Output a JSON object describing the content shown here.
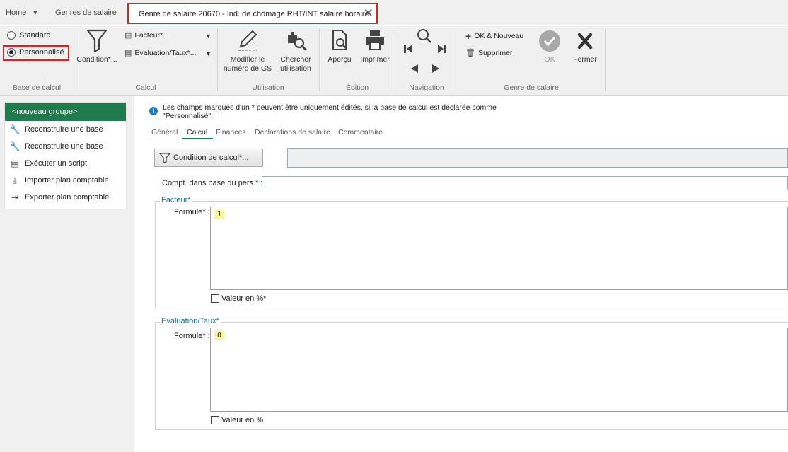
{
  "tabs": {
    "home": "Home",
    "genres": "Genres de salaire",
    "active": "Genre de salaire 20670 - Ind. de chômage RHT/INT salaire horaire"
  },
  "ribbon": {
    "base_calcul": {
      "standard": "Standard",
      "personnalise": "Personnalisé",
      "selected": "Personnalisé",
      "label": "Base de calcul"
    },
    "calcul": {
      "condition": "Condition*...",
      "facteur": "Facteur*...",
      "evaluation": "Evaluation/Taux*...",
      "label": "Calcul"
    },
    "utilisation": {
      "modifier_l1": "Modifier le",
      "modifier_l2": "numéro de GS",
      "chercher_l1": "Chercher",
      "chercher_l2": "utilisation",
      "label": "Utilisation"
    },
    "edition": {
      "apercu": "Aperçu",
      "imprimer": "Imprimer",
      "label": "Édition"
    },
    "navigation": {
      "label": "Navigation"
    },
    "genre": {
      "ok_nouveau": "OK & Nouveau",
      "supprimer": "Supprimer",
      "ok": "OK",
      "fermer": "Fermer",
      "label": "Genre de salaire"
    }
  },
  "sidebar": {
    "group": "<nouveau groupe>",
    "items": [
      {
        "label": "Reconstruire une base",
        "icon": "wrench-icon"
      },
      {
        "label": "Reconstruire une base",
        "icon": "wrench-icon"
      },
      {
        "label": "Exécuter un script",
        "icon": "script-icon"
      },
      {
        "label": "Importer plan comptable",
        "icon": "import-icon"
      },
      {
        "label": "Exporter plan comptable",
        "icon": "export-icon"
      }
    ]
  },
  "info": "Les champs marqués d'un * peuvent être uniquement édités, si la base de calcul est déclarée comme \"Personnalisé\".",
  "detail_tabs": [
    "Général",
    "Calcul",
    "Finances",
    "Déclarations de salaire",
    "Commentaire"
  ],
  "active_detail_tab": "Calcul",
  "condition_button": "Condition de calcul*...",
  "condition_value": "",
  "compt_label": "Compt. dans base du pers.* :",
  "compt_value": "",
  "facteur": {
    "legend": "Facteur*",
    "formula_label": "Formule* :",
    "formula_value": "1",
    "percent_label": "Valeur en %*",
    "percent_checked": false
  },
  "evaluation": {
    "legend": "Evaluation/Taux*",
    "formula_label": "Formule* :",
    "formula_value": "0",
    "percent_label": "Valeur en %",
    "percent_checked": false
  },
  "colors": {
    "accent_green": "#1f7a4e",
    "highlight_red": "#e02020",
    "formula_highlight": "#fbf79a"
  }
}
